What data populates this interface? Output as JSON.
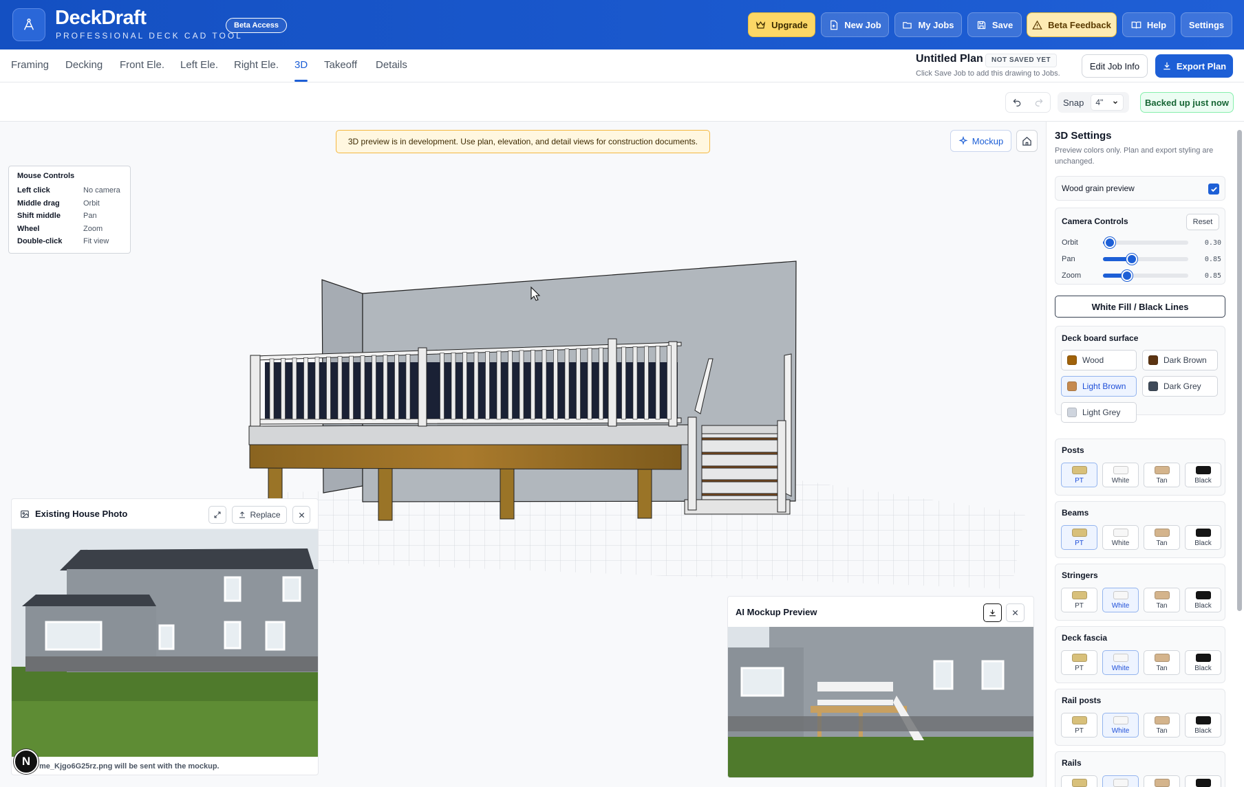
{
  "header": {
    "brand_title": "DeckDraft",
    "brand_subtitle": "PROFESSIONAL DECK CAD TOOL",
    "beta_badge": "Beta Access",
    "buttons": {
      "upgrade": "Upgrade",
      "new_job": "New Job",
      "my_jobs": "My Jobs",
      "save": "Save",
      "beta_feedback": "Beta Feedback",
      "help": "Help",
      "settings": "Settings"
    },
    "colors": {
      "bar": "#1a56c8",
      "upgrade": "#fcd766",
      "feedback": "#fdebb3"
    }
  },
  "tabs": [
    "Framing",
    "Decking",
    "Front Ele.",
    "Left Ele.",
    "Right Ele.",
    "3D",
    "Takeoff",
    "Details"
  ],
  "active_tab": "3D",
  "plan": {
    "title": "Untitled Plan",
    "status_badge": "NOT SAVED YET",
    "hint": "Click Save Job to add this drawing to Jobs.",
    "edit_job": "Edit Job Info",
    "export": "Export Plan"
  },
  "toolbar": {
    "snap_label": "Snap",
    "snap_value": "4\"",
    "backup_status": "Backed up just now"
  },
  "canvas": {
    "dev_banner": "3D preview is in development. Use plan, elevation, and detail views for construction documents.",
    "mockup_button": "Mockup",
    "mouse_controls": {
      "title": "Mouse Controls",
      "rows": [
        {
          "key": "Left click",
          "value": "No camera"
        },
        {
          "key": "Middle drag",
          "value": "Orbit"
        },
        {
          "key": "Shift middle",
          "value": "Pan"
        },
        {
          "key": "Wheel",
          "value": "Zoom"
        },
        {
          "key": "Double-click",
          "value": "Fit view"
        }
      ]
    }
  },
  "house_photo": {
    "title": "Existing House Photo",
    "replace": "Replace",
    "footer": "me_Kjgo6G25rz.png will be sent with the mockup."
  },
  "ai_mockup": {
    "title": "AI Mockup Preview"
  },
  "nav_badge": "N",
  "settings": {
    "title": "3D Settings",
    "subtitle": "Preview colors only. Plan and export styling are unchanged.",
    "wood_grain": {
      "label": "Wood grain preview",
      "checked": true
    },
    "camera": {
      "title": "Camera Controls",
      "reset": "Reset",
      "sliders": [
        {
          "label": "Orbit",
          "value": 0.3,
          "display": "0.30",
          "fraction": 0.08
        },
        {
          "label": "Pan",
          "value": 0.85,
          "display": "0.85",
          "fraction": 0.34
        },
        {
          "label": "Zoom",
          "value": 0.85,
          "display": "0.85",
          "fraction": 0.28
        }
      ]
    },
    "white_fill": "White Fill / Black Lines",
    "deck_surface": {
      "title": "Deck board surface",
      "options": [
        {
          "label": "Wood",
          "color": "#a0620a",
          "selected": false
        },
        {
          "label": "Dark Brown",
          "color": "#5c3412",
          "selected": false
        },
        {
          "label": "Light Brown",
          "color": "#c58a4e",
          "selected": true
        },
        {
          "label": "Dark Grey",
          "color": "#3f4a59",
          "selected": false
        },
        {
          "label": "Light Grey",
          "color": "#cfd5de",
          "selected": false
        }
      ]
    },
    "color_groups": [
      {
        "title": "Posts",
        "selected": "PT"
      },
      {
        "title": "Beams",
        "selected": "PT"
      },
      {
        "title": "Stringers",
        "selected": "White"
      },
      {
        "title": "Deck fascia",
        "selected": "White"
      },
      {
        "title": "Rail posts",
        "selected": "White"
      },
      {
        "title": "Rails",
        "selected": "White"
      }
    ],
    "color_options": [
      {
        "label": "PT",
        "color": "#d8c07a"
      },
      {
        "label": "White",
        "color": "#f7f7f7"
      },
      {
        "label": "Tan",
        "color": "#d4b48c"
      },
      {
        "label": "Black",
        "color": "#151515"
      }
    ]
  }
}
